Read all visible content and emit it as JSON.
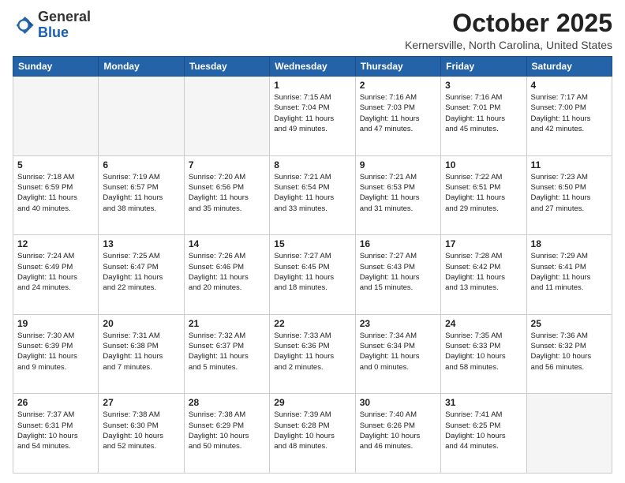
{
  "header": {
    "logo_general": "General",
    "logo_blue": "Blue",
    "month_title": "October 2025",
    "location": "Kernersville, North Carolina, United States"
  },
  "days_of_week": [
    "Sunday",
    "Monday",
    "Tuesday",
    "Wednesday",
    "Thursday",
    "Friday",
    "Saturday"
  ],
  "weeks": [
    [
      {
        "day": "",
        "text": ""
      },
      {
        "day": "",
        "text": ""
      },
      {
        "day": "",
        "text": ""
      },
      {
        "day": "1",
        "text": "Sunrise: 7:15 AM\nSunset: 7:04 PM\nDaylight: 11 hours\nand 49 minutes."
      },
      {
        "day": "2",
        "text": "Sunrise: 7:16 AM\nSunset: 7:03 PM\nDaylight: 11 hours\nand 47 minutes."
      },
      {
        "day": "3",
        "text": "Sunrise: 7:16 AM\nSunset: 7:01 PM\nDaylight: 11 hours\nand 45 minutes."
      },
      {
        "day": "4",
        "text": "Sunrise: 7:17 AM\nSunset: 7:00 PM\nDaylight: 11 hours\nand 42 minutes."
      }
    ],
    [
      {
        "day": "5",
        "text": "Sunrise: 7:18 AM\nSunset: 6:59 PM\nDaylight: 11 hours\nand 40 minutes."
      },
      {
        "day": "6",
        "text": "Sunrise: 7:19 AM\nSunset: 6:57 PM\nDaylight: 11 hours\nand 38 minutes."
      },
      {
        "day": "7",
        "text": "Sunrise: 7:20 AM\nSunset: 6:56 PM\nDaylight: 11 hours\nand 35 minutes."
      },
      {
        "day": "8",
        "text": "Sunrise: 7:21 AM\nSunset: 6:54 PM\nDaylight: 11 hours\nand 33 minutes."
      },
      {
        "day": "9",
        "text": "Sunrise: 7:21 AM\nSunset: 6:53 PM\nDaylight: 11 hours\nand 31 minutes."
      },
      {
        "day": "10",
        "text": "Sunrise: 7:22 AM\nSunset: 6:51 PM\nDaylight: 11 hours\nand 29 minutes."
      },
      {
        "day": "11",
        "text": "Sunrise: 7:23 AM\nSunset: 6:50 PM\nDaylight: 11 hours\nand 27 minutes."
      }
    ],
    [
      {
        "day": "12",
        "text": "Sunrise: 7:24 AM\nSunset: 6:49 PM\nDaylight: 11 hours\nand 24 minutes."
      },
      {
        "day": "13",
        "text": "Sunrise: 7:25 AM\nSunset: 6:47 PM\nDaylight: 11 hours\nand 22 minutes."
      },
      {
        "day": "14",
        "text": "Sunrise: 7:26 AM\nSunset: 6:46 PM\nDaylight: 11 hours\nand 20 minutes."
      },
      {
        "day": "15",
        "text": "Sunrise: 7:27 AM\nSunset: 6:45 PM\nDaylight: 11 hours\nand 18 minutes."
      },
      {
        "day": "16",
        "text": "Sunrise: 7:27 AM\nSunset: 6:43 PM\nDaylight: 11 hours\nand 15 minutes."
      },
      {
        "day": "17",
        "text": "Sunrise: 7:28 AM\nSunset: 6:42 PM\nDaylight: 11 hours\nand 13 minutes."
      },
      {
        "day": "18",
        "text": "Sunrise: 7:29 AM\nSunset: 6:41 PM\nDaylight: 11 hours\nand 11 minutes."
      }
    ],
    [
      {
        "day": "19",
        "text": "Sunrise: 7:30 AM\nSunset: 6:39 PM\nDaylight: 11 hours\nand 9 minutes."
      },
      {
        "day": "20",
        "text": "Sunrise: 7:31 AM\nSunset: 6:38 PM\nDaylight: 11 hours\nand 7 minutes."
      },
      {
        "day": "21",
        "text": "Sunrise: 7:32 AM\nSunset: 6:37 PM\nDaylight: 11 hours\nand 5 minutes."
      },
      {
        "day": "22",
        "text": "Sunrise: 7:33 AM\nSunset: 6:36 PM\nDaylight: 11 hours\nand 2 minutes."
      },
      {
        "day": "23",
        "text": "Sunrise: 7:34 AM\nSunset: 6:34 PM\nDaylight: 11 hours\nand 0 minutes."
      },
      {
        "day": "24",
        "text": "Sunrise: 7:35 AM\nSunset: 6:33 PM\nDaylight: 10 hours\nand 58 minutes."
      },
      {
        "day": "25",
        "text": "Sunrise: 7:36 AM\nSunset: 6:32 PM\nDaylight: 10 hours\nand 56 minutes."
      }
    ],
    [
      {
        "day": "26",
        "text": "Sunrise: 7:37 AM\nSunset: 6:31 PM\nDaylight: 10 hours\nand 54 minutes."
      },
      {
        "day": "27",
        "text": "Sunrise: 7:38 AM\nSunset: 6:30 PM\nDaylight: 10 hours\nand 52 minutes."
      },
      {
        "day": "28",
        "text": "Sunrise: 7:38 AM\nSunset: 6:29 PM\nDaylight: 10 hours\nand 50 minutes."
      },
      {
        "day": "29",
        "text": "Sunrise: 7:39 AM\nSunset: 6:28 PM\nDaylight: 10 hours\nand 48 minutes."
      },
      {
        "day": "30",
        "text": "Sunrise: 7:40 AM\nSunset: 6:26 PM\nDaylight: 10 hours\nand 46 minutes."
      },
      {
        "day": "31",
        "text": "Sunrise: 7:41 AM\nSunset: 6:25 PM\nDaylight: 10 hours\nand 44 minutes."
      },
      {
        "day": "",
        "text": ""
      }
    ]
  ]
}
